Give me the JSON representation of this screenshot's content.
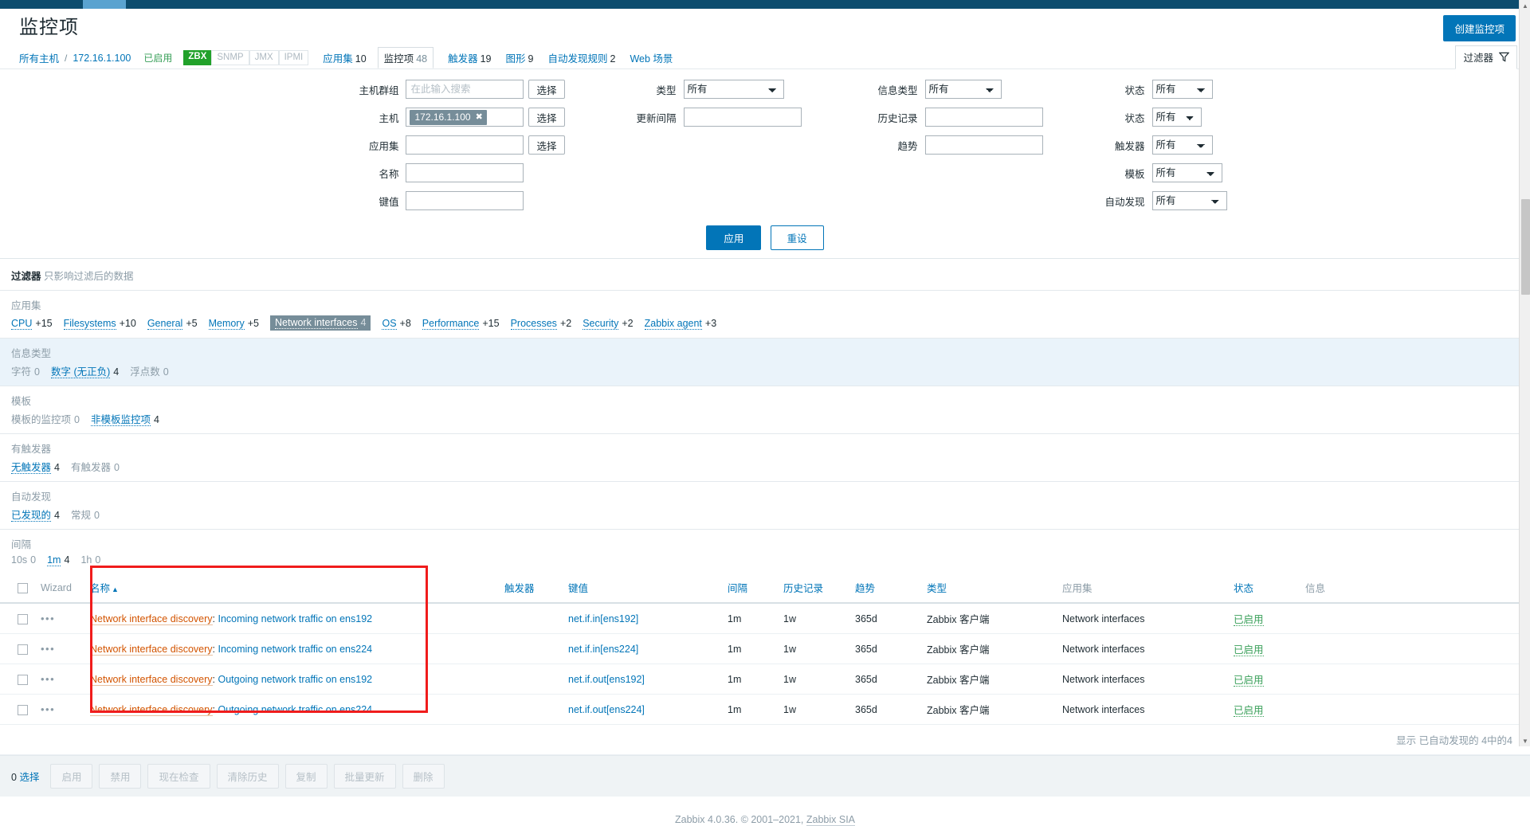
{
  "header": {
    "title": "监控项",
    "create_button": "创建监控项"
  },
  "breadcrumb": {
    "all_hosts": "所有主机",
    "separator": "/",
    "host": "172.16.1.100",
    "enabled": "已启用",
    "badges": [
      {
        "label": "ZBX",
        "active": true
      },
      {
        "label": "SNMP",
        "active": false
      },
      {
        "label": "JMX",
        "active": false
      },
      {
        "label": "IPMI",
        "active": false
      }
    ],
    "nav": [
      {
        "label": "应用集",
        "count": "10",
        "active": false
      },
      {
        "label": "监控项",
        "count": "48",
        "active": true
      },
      {
        "label": "触发器",
        "count": "19",
        "active": false
      },
      {
        "label": "图形",
        "count": "9",
        "active": false
      },
      {
        "label": "自动发现规则",
        "count": "2",
        "active": false
      },
      {
        "label": "Web 场景",
        "count": "",
        "active": false
      }
    ],
    "filter_tab": "过滤器"
  },
  "filter": {
    "host_group_label": "主机群组",
    "host_group_placeholder": "在此输入搜索",
    "host_label": "主机",
    "host_chip": "172.16.1.100",
    "app_label": "应用集",
    "app_value": "",
    "name_label": "名称",
    "name_value": "",
    "key_label": "键值",
    "key_value": "",
    "select_button": "选择",
    "type_label": "类型",
    "type_value": "所有",
    "update_interval_label": "更新间隔",
    "update_interval_value": "",
    "info_type_label": "信息类型",
    "info_type_value": "所有",
    "history_label": "历史记录",
    "history_value": "",
    "trend_label": "趋势",
    "trend_value": "",
    "state_label": "状态",
    "state_value": "所有",
    "status_label": "状态",
    "status_value": "所有",
    "trigger_label": "触发器",
    "trigger_value": "所有",
    "template_label": "模板",
    "template_value": "所有",
    "discovery_label": "自动发现",
    "discovery_value": "所有",
    "apply_button": "应用",
    "reset_button": "重设"
  },
  "subfilter": {
    "head_title": "过滤器",
    "head_note": "只影响过滤后的数据",
    "blocks": [
      {
        "title": "应用集",
        "alt": false,
        "items": [
          {
            "label": "CPU",
            "count": "+15",
            "zero": false,
            "selected": false
          },
          {
            "label": "Filesystems",
            "count": "+10",
            "zero": false,
            "selected": false
          },
          {
            "label": "General",
            "count": "+5",
            "zero": false,
            "selected": false
          },
          {
            "label": "Memory",
            "count": "+5",
            "zero": false,
            "selected": false
          },
          {
            "label": "Network interfaces",
            "count": "4",
            "zero": false,
            "selected": true
          },
          {
            "label": "OS",
            "count": "+8",
            "zero": false,
            "selected": false
          },
          {
            "label": "Performance",
            "count": "+15",
            "zero": false,
            "selected": false
          },
          {
            "label": "Processes",
            "count": "+2",
            "zero": false,
            "selected": false
          },
          {
            "label": "Security",
            "count": "+2",
            "zero": false,
            "selected": false
          },
          {
            "label": "Zabbix agent",
            "count": "+3",
            "zero": false,
            "selected": false
          }
        ]
      },
      {
        "title": "信息类型",
        "alt": true,
        "items": [
          {
            "label": "字符",
            "count": "0",
            "zero": true,
            "selected": false
          },
          {
            "label": "数字 (无正负)",
            "count": "4",
            "zero": false,
            "selected": false
          },
          {
            "label": "浮点数",
            "count": "0",
            "zero": true,
            "selected": false
          }
        ]
      },
      {
        "title": "模板",
        "alt": false,
        "items": [
          {
            "label": "模板的监控项",
            "count": "0",
            "zero": true,
            "selected": false
          },
          {
            "label": "非模板监控项",
            "count": "4",
            "zero": false,
            "selected": false
          }
        ]
      },
      {
        "title": "有触发器",
        "alt": false,
        "items": [
          {
            "label": "无触发器",
            "count": "4",
            "zero": false,
            "selected": false
          },
          {
            "label": "有触发器",
            "count": "0",
            "zero": true,
            "selected": false
          }
        ]
      },
      {
        "title": "自动发现",
        "alt": false,
        "items": [
          {
            "label": "已发现的",
            "count": "4",
            "zero": false,
            "selected": false
          },
          {
            "label": "常规",
            "count": "0",
            "zero": true,
            "selected": false
          }
        ]
      },
      {
        "title": "间隔",
        "alt": false,
        "items": [
          {
            "label": "10s",
            "count": "0",
            "zero": true,
            "selected": false
          },
          {
            "label": "1m",
            "count": "4",
            "zero": false,
            "selected": false
          },
          {
            "label": "1h",
            "count": "0",
            "zero": true,
            "selected": false
          }
        ]
      }
    ]
  },
  "table": {
    "columns": [
      "Wizard",
      "名称",
      "触发器",
      "键值",
      "间隔",
      "历史记录",
      "趋势",
      "类型",
      "应用集",
      "状态",
      "信息"
    ],
    "sort_column": "名称",
    "sort_arrow": "▲",
    "rows": [
      {
        "dots": "•••",
        "discovery": "Network interface discovery",
        "name": "Incoming network traffic on ens192",
        "trigger": "",
        "key": "net.if.in[ens192]",
        "interval": "1m",
        "history": "1w",
        "trend": "365d",
        "type": "Zabbix 客户端",
        "application": "Network interfaces",
        "status": "已启用",
        "info": ""
      },
      {
        "dots": "•••",
        "discovery": "Network interface discovery",
        "name": "Incoming network traffic on ens224",
        "trigger": "",
        "key": "net.if.in[ens224]",
        "interval": "1m",
        "history": "1w",
        "trend": "365d",
        "type": "Zabbix 客户端",
        "application": "Network interfaces",
        "status": "已启用",
        "info": ""
      },
      {
        "dots": "•••",
        "discovery": "Network interface discovery",
        "name": "Outgoing network traffic on ens192",
        "trigger": "",
        "key": "net.if.out[ens192]",
        "interval": "1m",
        "history": "1w",
        "trend": "365d",
        "type": "Zabbix 客户端",
        "application": "Network interfaces",
        "status": "已启用",
        "info": ""
      },
      {
        "dots": "•••",
        "discovery": "Network interface discovery",
        "name": "Outgoing network traffic on ens224",
        "trigger": "",
        "key": "net.if.out[ens224]",
        "interval": "1m",
        "history": "1w",
        "trend": "365d",
        "type": "Zabbix 客户端",
        "application": "Network interfaces",
        "status": "已启用",
        "info": ""
      }
    ],
    "footer_note": "显示 已自动发现的 4中的4"
  },
  "actionbar": {
    "selected_count": "0",
    "selected_label": "选择",
    "buttons": [
      "启用",
      "禁用",
      "现在检查",
      "清除历史",
      "复制",
      "批量更新",
      "删除"
    ]
  },
  "footer": {
    "text": "Zabbix 4.0.36. © 2001–2021, ",
    "link": "Zabbix SIA"
  }
}
